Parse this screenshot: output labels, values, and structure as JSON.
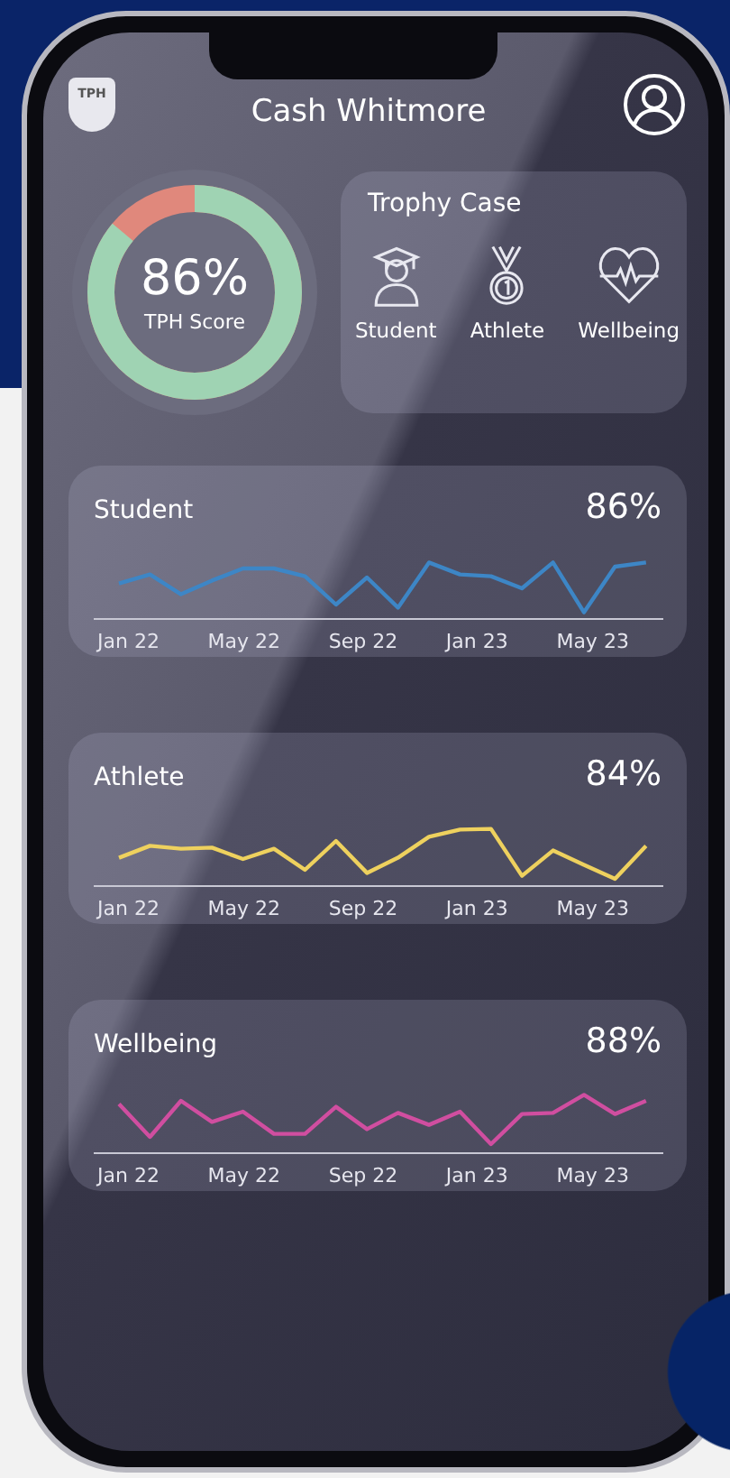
{
  "header": {
    "logo": "TPH",
    "title": "Cash Whitmore"
  },
  "score": {
    "value": "86%",
    "label": "TPH Score",
    "level": 0.86
  },
  "trophy_case": {
    "title": "Trophy Case",
    "trophies": [
      {
        "kind": "student",
        "label": "Student"
      },
      {
        "kind": "athlete",
        "label": "Athlete"
      },
      {
        "kind": "wellbeing",
        "label": "Wellbeing"
      }
    ]
  },
  "cards": [
    {
      "kind": "student",
      "title": "Student",
      "value": "86%",
      "color": "#3d86c6",
      "x_labels": [
        "Jan 22",
        "May 22",
        "Sep 22",
        "Jan 23",
        "May 23"
      ]
    },
    {
      "kind": "athlete",
      "title": "Athlete",
      "value": "84%",
      "color": "#eed15e",
      "x_labels": [
        "Jan 22",
        "May 22",
        "Sep 22",
        "Jan 23",
        "May 23"
      ]
    },
    {
      "kind": "wellbeing",
      "title": "Wellbeing",
      "value": "88%",
      "color": "#d04ea0",
      "x_labels": [
        "Jan 22",
        "May 22",
        "Sep 22",
        "Jan 23",
        "May 23"
      ]
    }
  ]
}
